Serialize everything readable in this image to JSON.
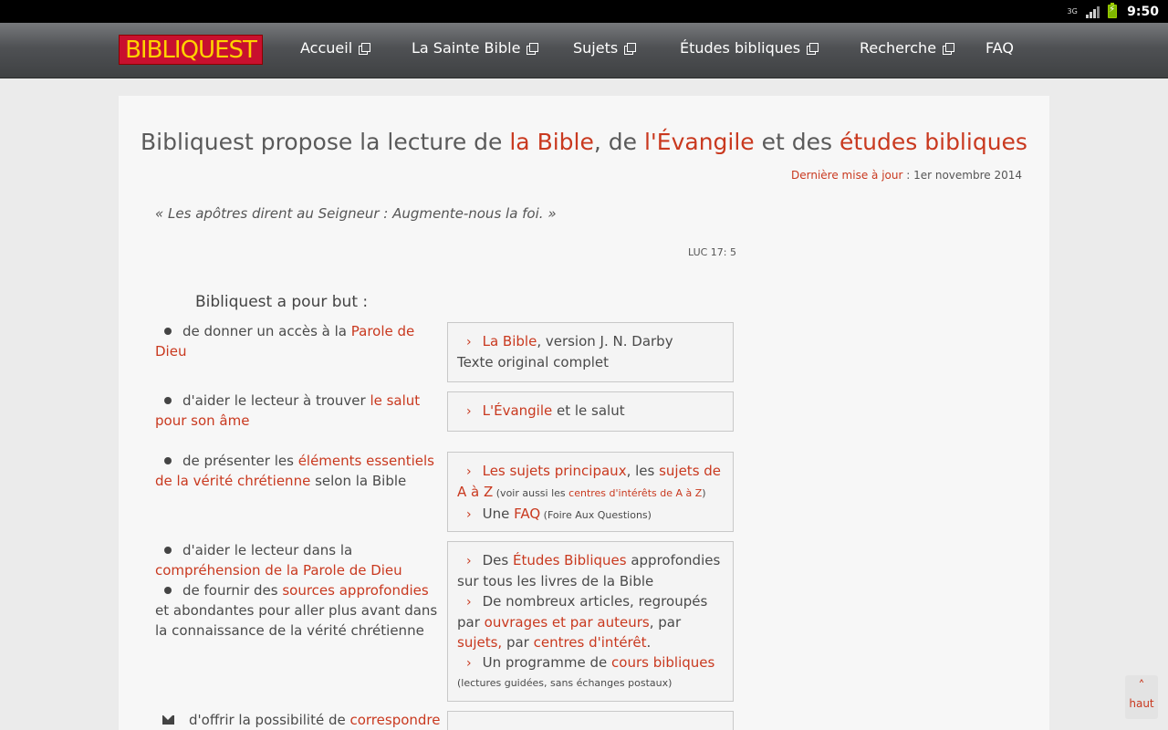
{
  "statusbar": {
    "network": "3G",
    "time": "9:50"
  },
  "nav": {
    "logo_text": "BIBLIQUEST",
    "items": [
      {
        "label": "Accueil"
      },
      {
        "label": "La Sainte Bible"
      },
      {
        "label": "Sujets"
      },
      {
        "label": "Études bibliques"
      },
      {
        "label": "Recherche"
      },
      {
        "label": "FAQ"
      }
    ]
  },
  "headline": {
    "t1": "Bibliquest propose la lecture de ",
    "l1": "la Bible",
    "t2": ", de ",
    "l2": "l'Évangile",
    "t3": " et des ",
    "l3": "études bibliques"
  },
  "update": {
    "label": "Dernière mise à jour",
    "sep": " : ",
    "date": "1er novembre 2014"
  },
  "quote": {
    "text": "« Les apôtres dirent au Seigneur : Augmente-nous la foi. »",
    "ref": "LUC 17: 5"
  },
  "goals": {
    "title": "Bibliquest a pour but :",
    "g1": {
      "t1": "de donner un accès à la ",
      "l1": "Parole de Dieu"
    },
    "g2": {
      "t1": "d'aider le lecteur à trouver ",
      "l1": "le salut pour son âme"
    },
    "g3": {
      "t1": "de présenter les ",
      "l1": "éléments essentiels de la vérité chrétienne",
      "t2": " selon la Bible"
    },
    "g4": {
      "t1": "d'aider le lecteur dans la ",
      "l1": "compréhension de la Parole de Dieu"
    },
    "g5": {
      "t1": "de fournir des ",
      "l1": "sources approfondies",
      "t2": " et abondantes pour aller plus avant dans la connaissance de la vérité chrétienne"
    },
    "g6": {
      "t1": "d'offrir la possibilité de ",
      "l1": "correspondre"
    }
  },
  "boxes": {
    "b1": {
      "l1": "La Bible",
      "t1": ", version J. N. Darby",
      "t2": "Texte original complet"
    },
    "b2": {
      "l1": "L'Évangile",
      "t1": " et le salut"
    },
    "b3": {
      "l1": "Les sujets principaux",
      "t1": ", les ",
      "l2": "sujets de A à Z",
      "s1": " (voir aussi les ",
      "sl1": "centres d'intérêts de A à Z",
      "s2": ")",
      "t2": "Une ",
      "l3": "FAQ",
      "s3": " (Foire Aux Questions)"
    },
    "b4": {
      "t1": "Des ",
      "l1": "Études Bibliques",
      "t2": " approfondies sur tous les livres de la Bible",
      "t3": "De nombreux articles, regroupés par ",
      "l2": "ouvrages et par auteurs",
      "t4": ", par ",
      "l3": "sujets,",
      "t5": " par ",
      "l4": "centres d'intérêt",
      "t6": ".",
      "t7": "Un programme de ",
      "l5": "cours bibliques",
      "s1": "(lectures guidées, sans échanges postaux)"
    }
  },
  "up_button": {
    "label": "haut"
  }
}
